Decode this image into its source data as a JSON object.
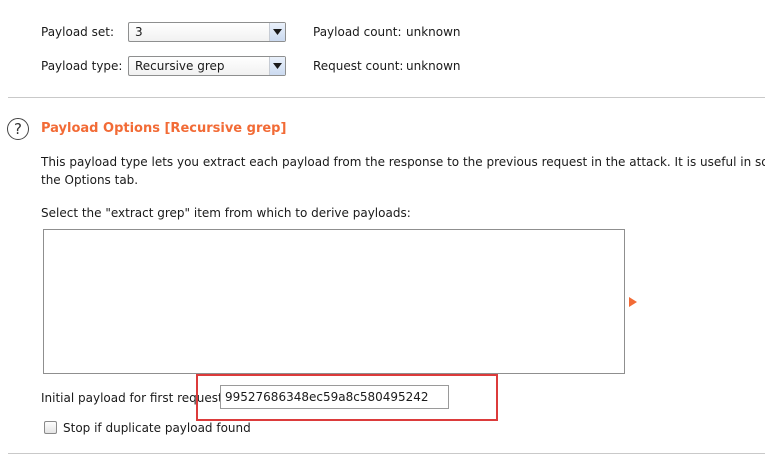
{
  "payload_set": {
    "label": "Payload set:",
    "value": "3"
  },
  "payload_type": {
    "label": "Payload type:",
    "value": "Recursive grep"
  },
  "payload_count": {
    "label": "Payload count:",
    "value": "unknown"
  },
  "request_count": {
    "label": "Request count:",
    "value": "unknown"
  },
  "section": {
    "title": "Payload Options [Recursive grep]",
    "description_line1": "This payload type lets you extract each payload from the response to the previous request in the attack. It is useful in some s",
    "description_line2": "the Options tab.",
    "extract_label": "Select the \"extract grep\" item from which to derive payloads:"
  },
  "initial_payload": {
    "label": "Initial payload for first request:",
    "value": "99527686348ec59a8c580495242"
  },
  "stop_duplicate": {
    "label": "Stop if duplicate payload found",
    "checked": false
  },
  "colors": {
    "accent": "#f26b36",
    "highlight": "#dc3b3b"
  },
  "icons": {
    "help": "question-circle-icon",
    "dropdown": "chevron-down-icon",
    "expander": "triangle-right-icon"
  }
}
